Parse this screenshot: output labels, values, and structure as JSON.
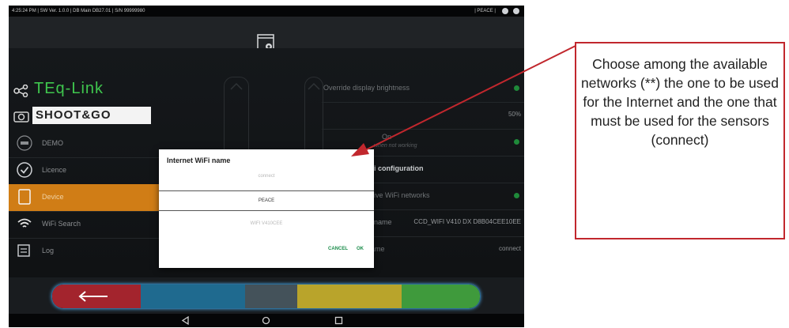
{
  "status_bar": {
    "left_text": "4:25:24 PM  |  SW Ver. 1.0.0  |  DB Main DB27.01  |  S/N 99999980",
    "right_text": "| PEACE |"
  },
  "brand": {
    "teq_link": "TEq-Link",
    "shoot_go_logo": "SHOOT&GO"
  },
  "sidebar": {
    "items": [
      {
        "label": "DEMO"
      },
      {
        "label": "Licence"
      },
      {
        "label": "Device"
      },
      {
        "label": "WiFi Search"
      },
      {
        "label": "Log"
      }
    ]
  },
  "settings": {
    "override_brightness": "Override display brightness",
    "brightness_value": "50%",
    "on_label": "On",
    "on_sub": "when not working",
    "wifi_config": "i configuration",
    "wifi_networks": "ive WiFi networks",
    "internet_wifi_name_label": "name",
    "internet_wifi_name_value": "CCD_WIFI V410 DX D8B04CEE10EE",
    "heads_wifi_label": "Heads WiFi name",
    "heads_wifi_value": "connect"
  },
  "dialog": {
    "title": "Internet WiFi name",
    "options": [
      "connect",
      "PEACE",
      "WIFI V410CEE"
    ],
    "selected_index": 1,
    "cancel_label": "CANCEL",
    "ok_label": "OK"
  },
  "bottom_bar": {
    "segment_colors": [
      "#a3242d",
      "#1f6a8f",
      "#44525a",
      "#b9a42b",
      "#3f9a3c"
    ]
  },
  "annotation": {
    "text": "Choose among the available networks (**) the one to be used for the Internet and the one that must be used for the sensors (connect)",
    "border_color": "#c1272d"
  }
}
